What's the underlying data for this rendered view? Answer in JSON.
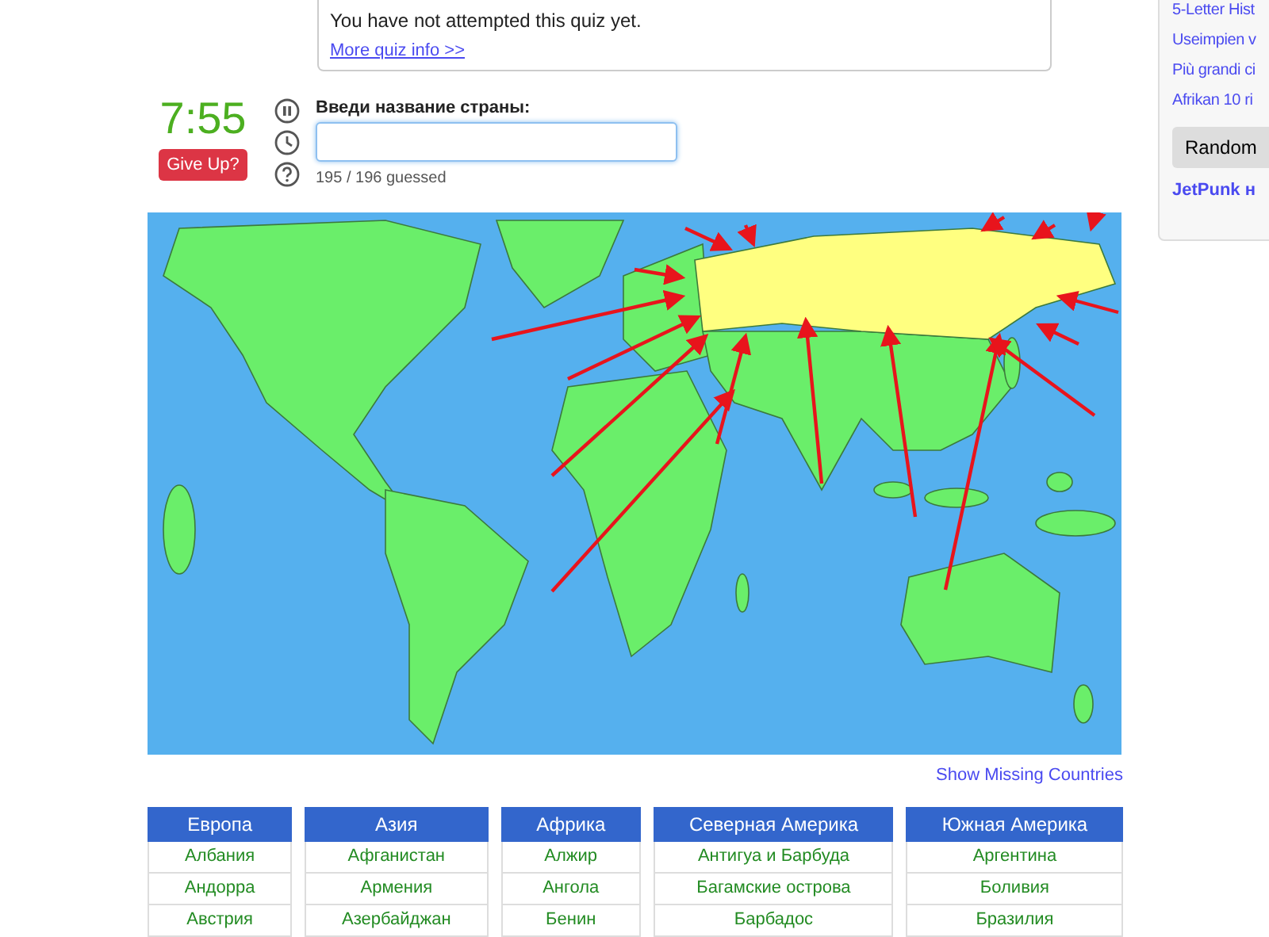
{
  "quiz_info": {
    "status": "You have not attempted this quiz yet.",
    "link": "More quiz info >>"
  },
  "sidebar": {
    "links": [
      "5-Letter Hist",
      "Useimpien v",
      "Più grandi ci",
      "Afrikan 10 ri"
    ],
    "button": "Random",
    "heading": "JetPunk н"
  },
  "quiz": {
    "timer": "7:55",
    "give_up": "Give Up?",
    "prompt": "Введи название страны:",
    "progress": "195 / 196 guessed"
  },
  "show_missing": "Show Missing Countries",
  "columns": [
    {
      "heading": "Европа",
      "rows": [
        "Албания",
        "Андорра",
        "Австрия"
      ]
    },
    {
      "heading": "Азия",
      "rows": [
        "Афганистан",
        "Армения",
        "Азербайджан"
      ]
    },
    {
      "heading": "Африка",
      "rows": [
        "Алжир",
        "Ангола",
        "Бенин"
      ]
    },
    {
      "heading": "Северная Америка",
      "rows": [
        "Антигуа и Барбуда",
        "Багамские острова",
        "Барбадос"
      ]
    },
    {
      "heading": "Южная Америка",
      "rows": [
        "Аргентина",
        "Боливия",
        "Бразилия"
      ]
    }
  ]
}
